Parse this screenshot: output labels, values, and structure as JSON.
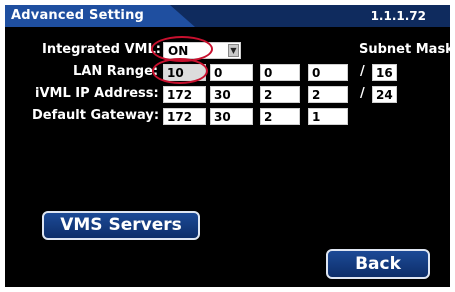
{
  "window": {
    "title": "Advanced Setting",
    "version": "1.1.1.72"
  },
  "form": {
    "integrated_vml": {
      "label": "Integrated VML:",
      "value": "ON",
      "arrow": "▼"
    },
    "subnet_label": "Subnet Mask:",
    "lan_range": {
      "label": "LAN Range:",
      "octets": [
        "10",
        "0",
        "0",
        "0"
      ],
      "mask": "16"
    },
    "ivml_ip": {
      "label": "iVML IP Address:",
      "octets": [
        "172",
        "30",
        "2",
        "2"
      ],
      "mask": "24"
    },
    "gateway": {
      "label": "Default Gateway:",
      "octets": [
        "172",
        "30",
        "2",
        "1"
      ]
    },
    "separator": "/"
  },
  "buttons": {
    "vms_servers": "VMS Servers",
    "back": "Back"
  },
  "accent": {
    "highlight_ring": "#c8102e",
    "title_bar": "#1f4fa0"
  }
}
